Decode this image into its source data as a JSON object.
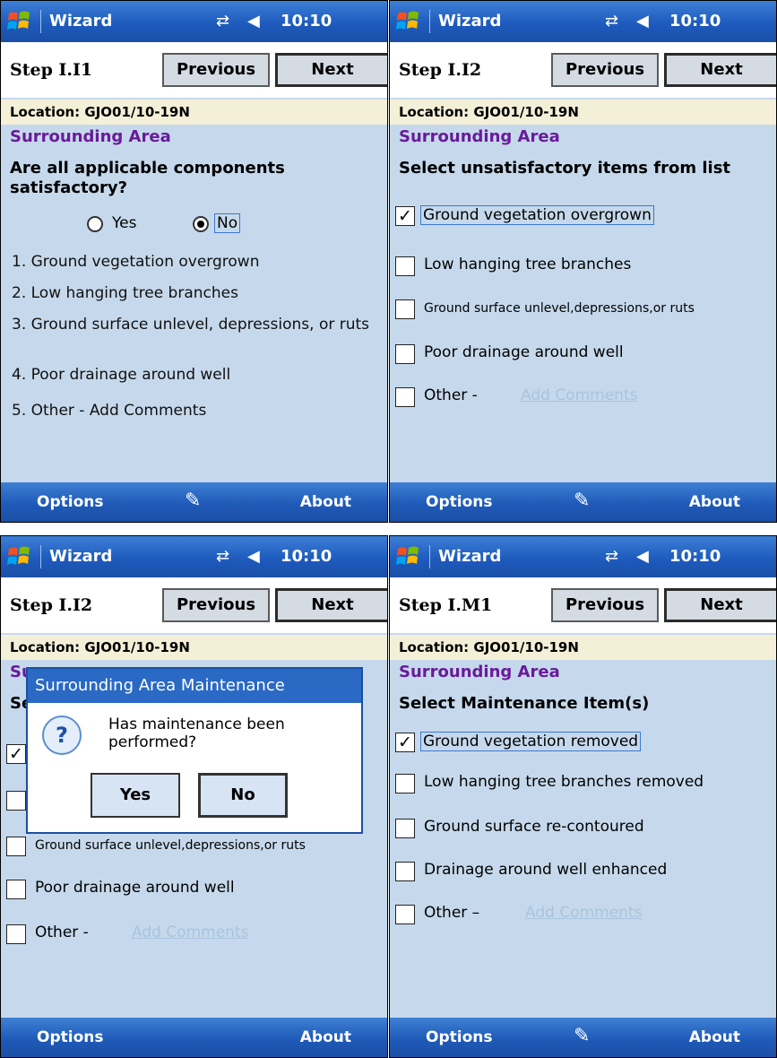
{
  "common": {
    "app_title": "Wizard",
    "time": "10:10",
    "previous_label": "Previous",
    "next_label": "Next",
    "location": "Location: GJO01/10-19N",
    "section": "Surrounding Area",
    "options_label": "Options",
    "about_label": "About",
    "add_comments": "Add Comments"
  },
  "screen1": {
    "step": "Step I.I1",
    "question": "Are all applicable components satisfactory?",
    "yes_label": "Yes",
    "no_label": "No",
    "selected": "No",
    "items": [
      "1. Ground vegetation overgrown",
      "2. Low hanging tree branches",
      "3. Ground surface unlevel, depressions, or ruts",
      "4. Poor drainage around well",
      "5. Other - Add Comments"
    ]
  },
  "screen2": {
    "step": "Step I.I2",
    "prompt": "Select unsatisfactory items from list",
    "items": [
      {
        "label": "Ground vegetation overgrown",
        "checked": true
      },
      {
        "label": "Low hanging tree branches",
        "checked": false
      },
      {
        "label": "Ground surface unlevel,depressions,or ruts",
        "checked": false
      },
      {
        "label": "Poor drainage around well",
        "checked": false
      },
      {
        "label": "Other -",
        "checked": false
      }
    ]
  },
  "screen3": {
    "step": "Step I.I2",
    "dialog_title": "Surrounding Area Maintenance",
    "dialog_message": "Has maintenance been performed?",
    "dialog_yes": "Yes",
    "dialog_no": "No",
    "partial_section": "Su",
    "partial_prompt": "Se",
    "items": [
      {
        "label": "Ground surface unlevel,depressions,or ruts",
        "checked": false
      },
      {
        "label": "Poor drainage around well",
        "checked": false
      },
      {
        "label": "Other -",
        "checked": false
      }
    ]
  },
  "screen4": {
    "step": "Step I.M1",
    "prompt": "Select Maintenance Item(s)",
    "items": [
      {
        "label": "Ground vegetation removed",
        "checked": true
      },
      {
        "label": "Low hanging tree branches removed",
        "checked": false
      },
      {
        "label": "Ground surface re-contoured",
        "checked": false
      },
      {
        "label": "Drainage around well enhanced",
        "checked": false
      },
      {
        "label": "Other –",
        "checked": false
      }
    ]
  }
}
